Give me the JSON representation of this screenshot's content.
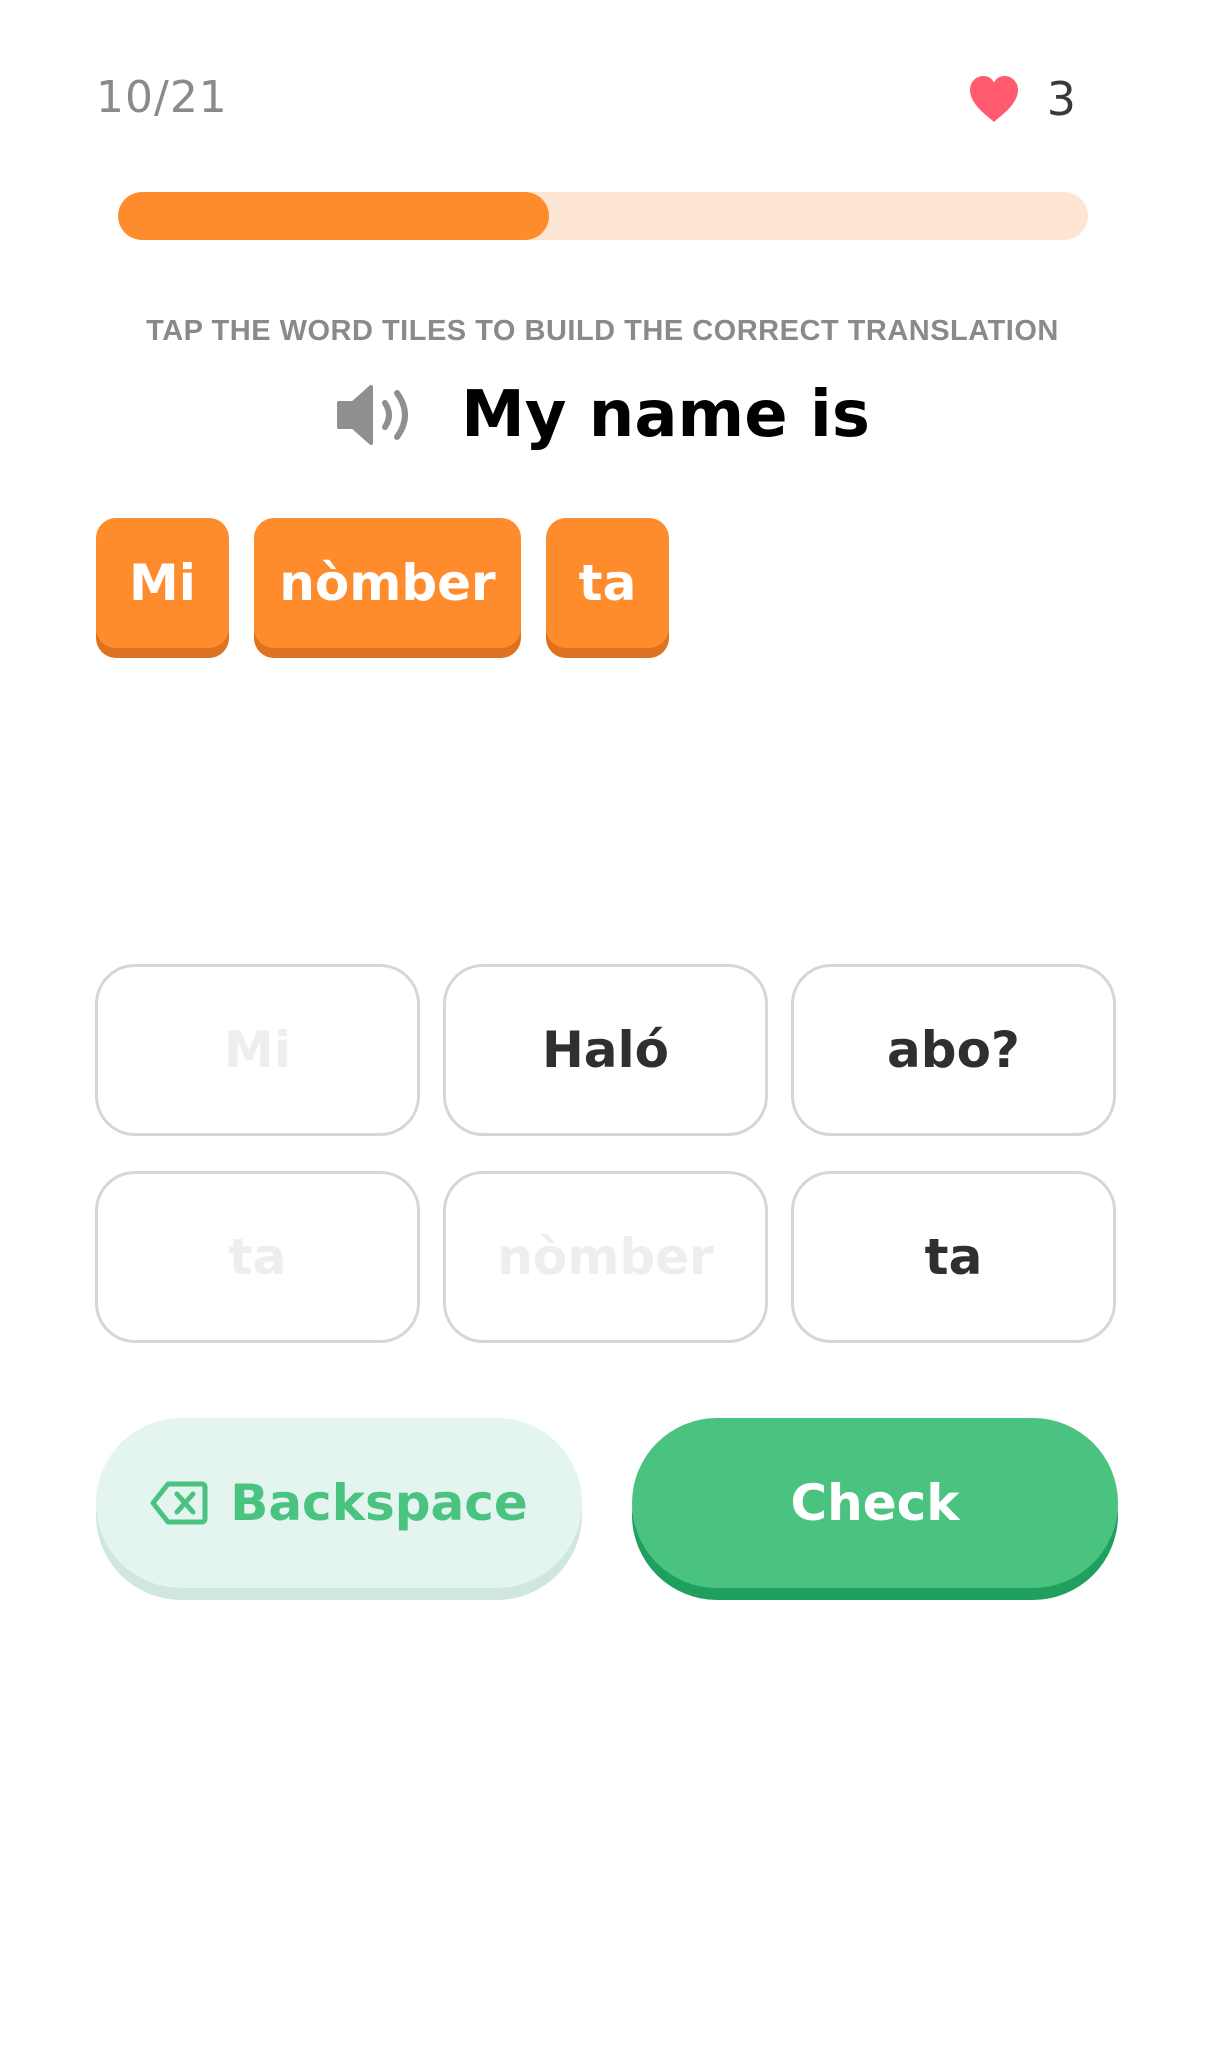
{
  "header": {
    "progress_label": "10/21",
    "hearts_count": "3"
  },
  "progress": {
    "current": 10,
    "total": 21,
    "fraction": 0.444
  },
  "exercise": {
    "instruction": "TAP THE WORD TILES TO BUILD THE CORRECT TRANSLATION",
    "prompt": "My name is",
    "answer_tiles": [
      "Mi",
      "nòmber",
      "ta"
    ]
  },
  "word_bank": [
    {
      "label": "Mi",
      "used": true
    },
    {
      "label": "Haló",
      "used": false
    },
    {
      "label": "abo?",
      "used": false
    },
    {
      "label": "ta",
      "used": true
    },
    {
      "label": "nòmber",
      "used": true
    },
    {
      "label": "ta",
      "used": false
    }
  ],
  "actions": {
    "backspace_label": "Backspace",
    "check_label": "Check"
  },
  "icons": {
    "heart": "heart-icon",
    "speaker": "speaker-icon",
    "backspace": "backspace-icon"
  },
  "colors": {
    "accent_orange": "#fe8b2c",
    "progress_track": "#fde6d3",
    "heart": "#ff5a6e",
    "primary_green": "#4ac381",
    "backspace_bg": "#e3f5ee"
  }
}
